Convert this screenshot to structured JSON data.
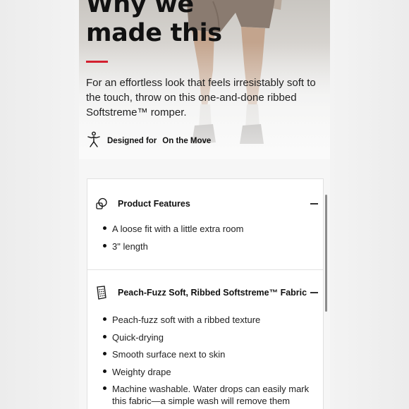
{
  "hero": {
    "heading": "Why we\nmade this",
    "intro": "For an effortless look that feels irresistably soft to the touch, throw on this one-and-done ribbed Softstreme™ romper.",
    "designed_label": "Designed for",
    "designed_target": "On the Move",
    "designed_icon": "running-person-icon",
    "accent_color": "#d3202f"
  },
  "features_card": {
    "sections": [
      {
        "title": "Product Features",
        "icon": "fabric-swatch-icon",
        "expanded": true,
        "items": [
          "A loose fit with a little extra room",
          "3\" length"
        ]
      },
      {
        "title": "Peach-Fuzz Soft, Ribbed Softstreme™ Fabric",
        "icon": "textured-tag-icon",
        "expanded": true,
        "items": [
          "Peach-fuzz soft with a ribbed texture",
          "Quick-drying",
          "Smooth surface next to skin",
          "Weighty drape",
          "Machine washable. Water drops can easily mark this fabric—a simple wash will remove them"
        ]
      }
    ]
  }
}
